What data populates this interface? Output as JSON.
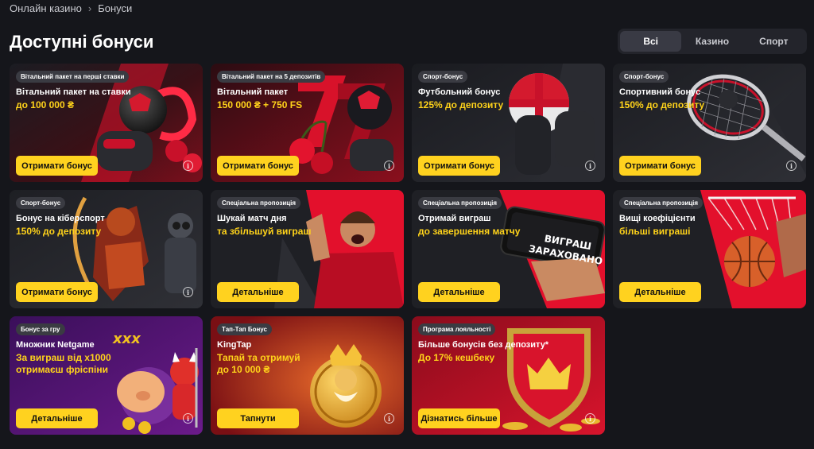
{
  "breadcrumb": {
    "home": "Онлайн казино",
    "current": "Бонуси"
  },
  "page_title": "Доступні бонуси",
  "filters": [
    {
      "label": "Всі",
      "active": true
    },
    {
      "label": "Казино",
      "active": false
    },
    {
      "label": "Спорт",
      "active": false
    }
  ],
  "cards": [
    {
      "tag": "Вітальний пакет на перші ставки",
      "title": "Вітальний пакет на ставки",
      "highlight": "до 100 000 ₴",
      "button": "Отримати бонус"
    },
    {
      "tag": "Вітальний пакет на 5 депозитів",
      "title": "Вітальний пакет",
      "highlight": "150 000 ₴ + 750 FS",
      "button": "Отримати бонус"
    },
    {
      "tag": "Спорт-бонус",
      "title": "Футбольний бонус",
      "highlight": "125% до депозиту",
      "button": "Отримати бонус"
    },
    {
      "tag": "Спорт-бонус",
      "title": "Спортивний бонус",
      "highlight": "150% до депозиту",
      "button": "Отримати бонус"
    },
    {
      "tag": "Спорт-бонус",
      "title": "Бонус на кіберспорт",
      "highlight": "150% до депозиту",
      "button": "Отримати бонус"
    },
    {
      "tag": "Спеціальна пропозиція",
      "title": "Шукай матч дня",
      "highlight": "та збільшуй виграш",
      "button": "Детальніше"
    },
    {
      "tag": "Спеціальна пропозиція",
      "title": "Отримай виграш",
      "highlight": "до завершення матчу",
      "button": "Детальніше",
      "phone_text_1": "ВИГРАШ",
      "phone_text_2": "ЗАРАХОВАНО"
    },
    {
      "tag": "Спеціальна пропозиція",
      "title": "Вищі коефіцієнти",
      "highlight": "більші виграші",
      "button": "Детальніше"
    },
    {
      "tag": "Бонус за гру",
      "title": "Множник Netgame",
      "highlight": "За виграш від х1000",
      "highlight2": "отримаєш фріспіни",
      "button": "Детальніше",
      "deco": "xxx"
    },
    {
      "tag": "Тап-Тап Бонус",
      "title": "KingTap",
      "highlight": "Тапай та отримуй",
      "highlight2": "до 10 000 ₴",
      "button": "Тапнути"
    },
    {
      "tag": "Програма лояльності",
      "title": "Більше бонусів без депозиту*",
      "highlight": "До 17% кешбеку",
      "button": "Дізнатись більше"
    }
  ],
  "info_icon": "ⓘ",
  "colors": {
    "accent": "#ffd21f",
    "background": "#15161b",
    "highlight_text": "#ffd31a"
  }
}
